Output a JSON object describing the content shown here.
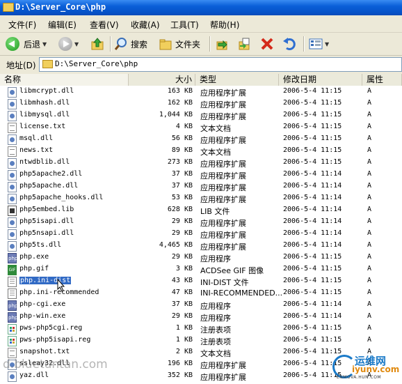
{
  "window": {
    "title": "D:\\Server_Core\\php"
  },
  "menu": [
    "文件(F)",
    "编辑(E)",
    "查看(V)",
    "收藏(A)",
    "工具(T)",
    "帮助(H)"
  ],
  "toolbar": {
    "back_label": "后退",
    "search_label": "搜索",
    "folders_label": "文件夹"
  },
  "address": {
    "label": "地址(D)",
    "value": "D:\\Server_Core\\php"
  },
  "columns": {
    "name": "名称",
    "size": "大小",
    "type": "类型",
    "date": "修改日期",
    "attr": "属性"
  },
  "files": [
    {
      "name": "libmcrypt.dll",
      "size": "163 KB",
      "type": "应用程序扩展",
      "date": "2006-5-4 11:15",
      "attr": "A",
      "icon": "dll-icon"
    },
    {
      "name": "libmhash.dll",
      "size": "162 KB",
      "type": "应用程序扩展",
      "date": "2006-5-4 11:15",
      "attr": "A",
      "icon": "dll-icon"
    },
    {
      "name": "libmysql.dll",
      "size": "1,044 KB",
      "type": "应用程序扩展",
      "date": "2006-5-4 11:15",
      "attr": "A",
      "icon": "dll-icon"
    },
    {
      "name": "license.txt",
      "size": "4 KB",
      "type": "文本文档",
      "date": "2006-5-4 11:15",
      "attr": "A",
      "icon": "txt-icon"
    },
    {
      "name": "msql.dll",
      "size": "56 KB",
      "type": "应用程序扩展",
      "date": "2006-5-4 11:15",
      "attr": "A",
      "icon": "dll-icon"
    },
    {
      "name": "news.txt",
      "size": "89 KB",
      "type": "文本文档",
      "date": "2006-5-4 11:15",
      "attr": "A",
      "icon": "txt-icon"
    },
    {
      "name": "ntwdblib.dll",
      "size": "273 KB",
      "type": "应用程序扩展",
      "date": "2006-5-4 11:15",
      "attr": "A",
      "icon": "dll-icon"
    },
    {
      "name": "php5apache2.dll",
      "size": "37 KB",
      "type": "应用程序扩展",
      "date": "2006-5-4 11:14",
      "attr": "A",
      "icon": "dll-icon"
    },
    {
      "name": "php5apache.dll",
      "size": "37 KB",
      "type": "应用程序扩展",
      "date": "2006-5-4 11:14",
      "attr": "A",
      "icon": "dll-icon"
    },
    {
      "name": "php5apache_hooks.dll",
      "size": "53 KB",
      "type": "应用程序扩展",
      "date": "2006-5-4 11:14",
      "attr": "A",
      "icon": "dll-icon"
    },
    {
      "name": "php5embed.lib",
      "size": "628 KB",
      "type": "LIB 文件",
      "date": "2006-5-4 11:14",
      "attr": "A",
      "icon": "lib-icon"
    },
    {
      "name": "php5isapi.dll",
      "size": "29 KB",
      "type": "应用程序扩展",
      "date": "2006-5-4 11:14",
      "attr": "A",
      "icon": "dll-icon"
    },
    {
      "name": "php5nsapi.dll",
      "size": "29 KB",
      "type": "应用程序扩展",
      "date": "2006-5-4 11:14",
      "attr": "A",
      "icon": "dll-icon"
    },
    {
      "name": "php5ts.dll",
      "size": "4,465 KB",
      "type": "应用程序扩展",
      "date": "2006-5-4 11:14",
      "attr": "A",
      "icon": "dll-icon"
    },
    {
      "name": "php.exe",
      "size": "29 KB",
      "type": "应用程序",
      "date": "2006-5-4 11:15",
      "attr": "A",
      "icon": "php-exe-icon"
    },
    {
      "name": "php.gif",
      "size": "3 KB",
      "type": "ACDSee GIF 图像",
      "date": "2006-5-4 11:15",
      "attr": "A",
      "icon": "gif-icon"
    },
    {
      "name": "php.ini-dist",
      "size": "43 KB",
      "type": "INI-DIST 文件",
      "date": "2006-5-4 11:15",
      "attr": "A",
      "icon": "ini-icon",
      "selected": true
    },
    {
      "name": "php.ini-recommended",
      "size": "47 KB",
      "type": "INI-RECOMMENDED...",
      "date": "2006-5-4 11:15",
      "attr": "A",
      "icon": "ini-icon"
    },
    {
      "name": "php-cgi.exe",
      "size": "37 KB",
      "type": "应用程序",
      "date": "2006-5-4 11:14",
      "attr": "A",
      "icon": "php-exe-icon"
    },
    {
      "name": "php-win.exe",
      "size": "29 KB",
      "type": "应用程序",
      "date": "2006-5-4 11:14",
      "attr": "A",
      "icon": "php-exe-icon"
    },
    {
      "name": "pws-php5cgi.reg",
      "size": "1 KB",
      "type": "注册表项",
      "date": "2006-5-4 11:15",
      "attr": "A",
      "icon": "reg-icon"
    },
    {
      "name": "pws-php5isapi.reg",
      "size": "1 KB",
      "type": "注册表项",
      "date": "2006-5-4 11:15",
      "attr": "A",
      "icon": "reg-icon"
    },
    {
      "name": "snapshot.txt",
      "size": "2 KB",
      "type": "文本文档",
      "date": "2006-5-4 11:15",
      "attr": "A",
      "icon": "txt-icon"
    },
    {
      "name": "ssleay32.dll",
      "size": "196 KB",
      "type": "应用程序扩展",
      "date": "2006-5-4 11:15",
      "attr": "A",
      "icon": "dll-icon"
    },
    {
      "name": "yaz.dll",
      "size": "352 KB",
      "type": "应用程序扩展",
      "date": "2006-5-4 11:15",
      "attr": "A",
      "icon": "dll-icon"
    }
  ],
  "watermark": {
    "left_text": "d.bluetuntan.com",
    "logo_title": "运维网",
    "logo_url": "iyunv.com",
    "logo_sub": "ENMOVA.HUN.COM"
  }
}
